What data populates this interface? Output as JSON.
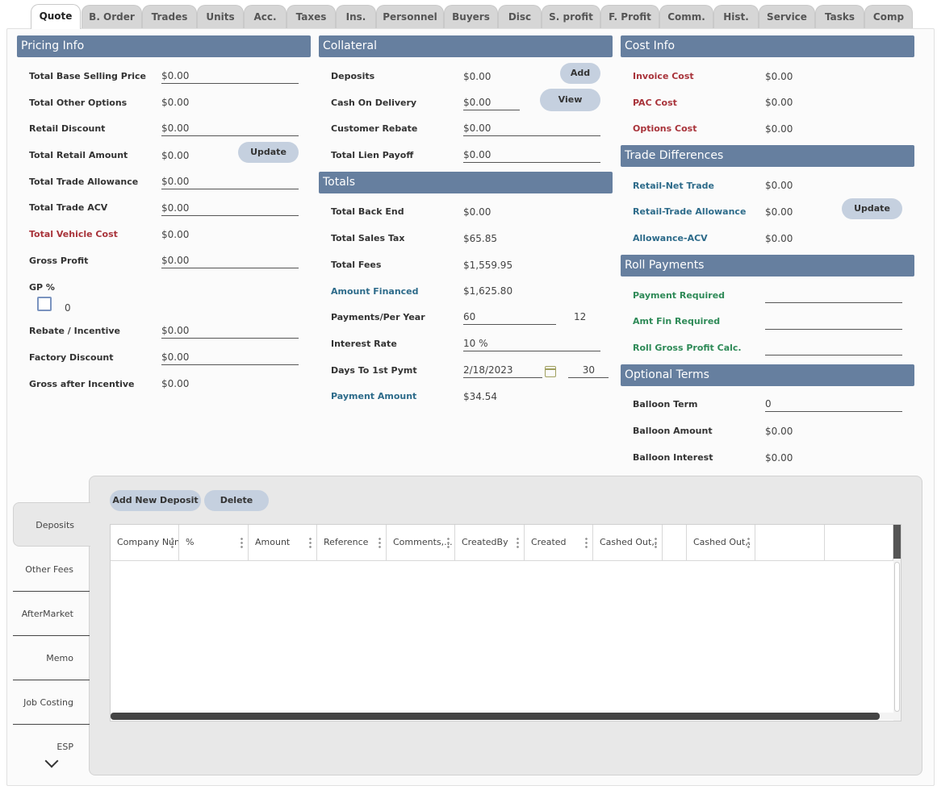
{
  "tabs": [
    "Quote",
    "B. Order",
    "Trades",
    "Units",
    "Acc.",
    "Taxes",
    "Ins.",
    "Personnel",
    "Buyers",
    "Disc",
    "S. profit",
    "F. Profit",
    "Comm.",
    "Hist.",
    "Service",
    "Tasks",
    "Comp"
  ],
  "pricing": {
    "title": "Pricing Info",
    "total_base_selling_price": {
      "label": "Total Base Selling Price",
      "value": "$0.00"
    },
    "total_other_options": {
      "label": "Total Other Options",
      "value": "$0.00"
    },
    "retail_discount": {
      "label": "Retail Discount",
      "value": "$0.00"
    },
    "total_retail_amount": {
      "label": "Total Retail Amount",
      "value": "$0.00"
    },
    "update_label": "Update",
    "total_trade_allowance": {
      "label": "Total Trade Allowance",
      "value": "$0.00"
    },
    "total_trade_acv": {
      "label": "Total Trade ACV",
      "value": "$0.00"
    },
    "total_vehicle_cost": {
      "label": "Total Vehicle Cost",
      "value": "$0.00"
    },
    "gross_profit": {
      "label": "Gross Profit",
      "value": "$0.00"
    },
    "gp_percent": {
      "label": "GP %",
      "value": "0"
    },
    "rebate_incentive": {
      "label": "Rebate / Incentive",
      "value": "$0.00"
    },
    "factory_discount": {
      "label": "Factory Discount",
      "value": "$0.00"
    },
    "gross_after_incentive": {
      "label": "Gross after Incentive",
      "value": "$0.00"
    }
  },
  "collateral": {
    "title": "Collateral",
    "deposits": {
      "label": "Deposits",
      "value": "$0.00"
    },
    "add_label": "Add",
    "cash_on_delivery": {
      "label": "Cash On Delivery",
      "value": "$0.00"
    },
    "view_label": "View",
    "customer_rebate": {
      "label": "Customer Rebate",
      "value": "$0.00"
    },
    "total_lien_payoff": {
      "label": "Total Lien Payoff",
      "value": "$0.00"
    }
  },
  "totals": {
    "title": "Totals",
    "total_back_end": {
      "label": "Total Back End",
      "value": "$0.00"
    },
    "total_sales_tax": {
      "label": "Total Sales Tax",
      "value": "$65.85"
    },
    "total_fees": {
      "label": "Total Fees",
      "value": "$1,559.95"
    },
    "amount_financed": {
      "label": "Amount Financed",
      "value": "$1,625.80"
    },
    "payments_per_year": {
      "label": "Payments/Per Year",
      "value": "60",
      "per_year": "12"
    },
    "interest_rate": {
      "label": "Interest Rate",
      "value": "10 %"
    },
    "days_to_first_pymt": {
      "label": "Days To 1st Pymt",
      "date": "2/18/2023",
      "days": "30"
    },
    "payment_amount": {
      "label": "Payment Amount",
      "value": "$34.54"
    }
  },
  "cost_info": {
    "title": "Cost Info",
    "invoice_cost": {
      "label": "Invoice Cost",
      "value": "$0.00"
    },
    "pac_cost": {
      "label": "PAC Cost",
      "value": "$0.00"
    },
    "options_cost": {
      "label": "Options Cost",
      "value": "$0.00"
    }
  },
  "trade_differences": {
    "title": "Trade Differences",
    "retail_net_trade": {
      "label": "Retail-Net Trade",
      "value": "$0.00"
    },
    "retail_trade_allowance": {
      "label": "Retail-Trade Allowance",
      "value": "$0.00"
    },
    "update_label": "Update",
    "allowance_acv": {
      "label": "Allowance-ACV",
      "value": "$0.00"
    }
  },
  "roll_payments": {
    "title": "Roll Payments",
    "payment_required": {
      "label": "Payment Required",
      "value": ""
    },
    "amt_fin_required": {
      "label": "Amt Fin Required",
      "value": ""
    },
    "roll_gross_profit": {
      "label": "Roll Gross Profit Calc.",
      "value": ""
    }
  },
  "optional_terms": {
    "title": "Optional Terms",
    "balloon_term": {
      "label": "Balloon Term",
      "value": "0"
    },
    "balloon_amount": {
      "label": "Balloon Amount",
      "value": "$0.00"
    },
    "balloon_interest": {
      "label": "Balloon Interest",
      "value": "$0.00"
    }
  },
  "side_tabs": [
    "Deposits",
    "Other Fees",
    "AfterMarket",
    "Memo",
    "Job Costing",
    "ESP"
  ],
  "deposits_toolbar": {
    "add_new_label": "Add New Deposit",
    "delete_label": "Delete"
  },
  "grid_columns": [
    "Company Num",
    "%",
    "Amount",
    "Reference",
    "Comments,...",
    "CreatedBy",
    "Created",
    "Cashed Out,.",
    "",
    "Cashed Out,.",
    "",
    ""
  ]
}
